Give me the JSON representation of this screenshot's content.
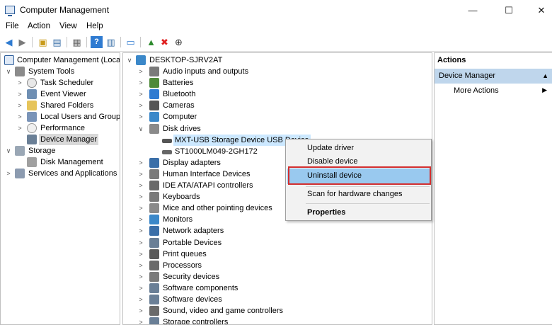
{
  "window": {
    "title": "Computer Management",
    "minimize": "—",
    "maximize": "☐",
    "close": "✕"
  },
  "menu": [
    "File",
    "Action",
    "View",
    "Help"
  ],
  "toolbar": {
    "icons": [
      "back-arrow-icon",
      "forward-arrow-icon",
      "up-folder-icon",
      "show-hide-tree-icon",
      "properties-icon",
      "help-icon",
      "help-topics-icon",
      "monitor-icon",
      "update-driver-icon",
      "uninstall-x-icon",
      "download-icon"
    ],
    "colors": {
      "blue": "#2f7bd1",
      "red": "#e02020",
      "green": "#2e8b2e"
    }
  },
  "left_tree": [
    {
      "label": "Computer Management (Local",
      "indent": 0,
      "chev": "∨",
      "icon": "computer-mgmt-icon"
    },
    {
      "label": "System Tools",
      "indent": 1,
      "chev": "∨",
      "icon": "toolbox-icon"
    },
    {
      "label": "Task Scheduler",
      "indent": 2,
      "chev": ">",
      "icon": "clock-icon"
    },
    {
      "label": "Event Viewer",
      "indent": 2,
      "chev": ">",
      "icon": "event-viewer-icon"
    },
    {
      "label": "Shared Folders",
      "indent": 2,
      "chev": ">",
      "icon": "shared-folder-icon"
    },
    {
      "label": "Local Users and Groups",
      "indent": 2,
      "chev": ">",
      "icon": "users-icon"
    },
    {
      "label": "Performance",
      "indent": 2,
      "chev": ">",
      "icon": "performance-icon"
    },
    {
      "label": "Device Manager",
      "indent": 2,
      "chev": "",
      "icon": "device-manager-icon",
      "selected": true
    },
    {
      "label": "Storage",
      "indent": 1,
      "chev": "∨",
      "icon": "storage-icon"
    },
    {
      "label": "Disk Management",
      "indent": 2,
      "chev": "",
      "icon": "disk-mgmt-icon"
    },
    {
      "label": "Services and Applications",
      "indent": 1,
      "chev": ">",
      "icon": "services-icon"
    }
  ],
  "device_tree": {
    "root": "DESKTOP-SJRV2AT",
    "items": [
      {
        "label": "Audio inputs and outputs",
        "chev": ">",
        "icon": "audio-icon"
      },
      {
        "label": "Batteries",
        "chev": ">",
        "icon": "battery-icon"
      },
      {
        "label": "Bluetooth",
        "chev": ">",
        "icon": "bluetooth-icon"
      },
      {
        "label": "Cameras",
        "chev": ">",
        "icon": "camera-icon"
      },
      {
        "label": "Computer",
        "chev": ">",
        "icon": "computer-icon"
      },
      {
        "label": "Disk drives",
        "chev": "∨",
        "icon": "disk-drive-icon"
      },
      {
        "label": "MXT-USB Storage Device USB Device",
        "chev": "",
        "icon": "usb-drive-icon",
        "child": true,
        "selected": true
      },
      {
        "label": "ST1000LM049-2GH172",
        "chev": "",
        "icon": "hdd-icon",
        "child": true
      },
      {
        "label": "Display adapters",
        "chev": ">",
        "icon": "display-adapter-icon"
      },
      {
        "label": "Human Interface Devices",
        "chev": ">",
        "icon": "hid-icon"
      },
      {
        "label": "IDE ATA/ATAPI controllers",
        "chev": ">",
        "icon": "ide-icon"
      },
      {
        "label": "Keyboards",
        "chev": ">",
        "icon": "keyboard-icon"
      },
      {
        "label": "Mice and other pointing devices",
        "chev": ">",
        "icon": "mouse-icon"
      },
      {
        "label": "Monitors",
        "chev": ">",
        "icon": "monitor-icon"
      },
      {
        "label": "Network adapters",
        "chev": ">",
        "icon": "network-icon"
      },
      {
        "label": "Portable Devices",
        "chev": ">",
        "icon": "portable-device-icon"
      },
      {
        "label": "Print queues",
        "chev": ">",
        "icon": "printer-icon"
      },
      {
        "label": "Processors",
        "chev": ">",
        "icon": "processor-icon"
      },
      {
        "label": "Security devices",
        "chev": ">",
        "icon": "security-icon"
      },
      {
        "label": "Software components",
        "chev": ">",
        "icon": "software-component-icon"
      },
      {
        "label": "Software devices",
        "chev": ">",
        "icon": "software-device-icon"
      },
      {
        "label": "Sound, video and game controllers",
        "chev": ">",
        "icon": "sound-icon"
      },
      {
        "label": "Storage controllers",
        "chev": ">",
        "icon": "storage-controller-icon"
      }
    ]
  },
  "actions": {
    "title": "Actions",
    "section": "Device Manager",
    "more": "More Actions"
  },
  "context_menu": {
    "update": "Update driver",
    "disable": "Disable device",
    "uninstall": "Uninstall device",
    "scan": "Scan for hardware changes",
    "properties": "Properties",
    "highlight_color": "#99c9ef",
    "annotation_color": "#d32f2f"
  }
}
